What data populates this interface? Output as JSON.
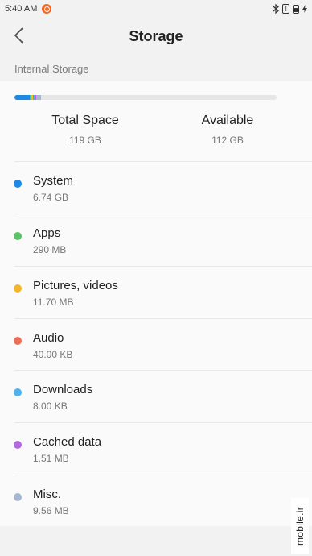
{
  "status_bar": {
    "time": "5:40 AM",
    "battery_mark": "!"
  },
  "header": {
    "title": "Storage"
  },
  "section": {
    "label": "Internal Storage"
  },
  "usage_bar": {
    "segments": [
      {
        "name": "system",
        "fraction": 0.059,
        "color": "#1e88e5"
      },
      {
        "name": "apps",
        "fraction": 0.005,
        "color": "#5cc26a"
      },
      {
        "name": "pictures",
        "fraction": 0.006,
        "color": "#f6b52e"
      },
      {
        "name": "audio",
        "fraction": 0.004,
        "color": "#ec6f55"
      },
      {
        "name": "downloads",
        "fraction": 0.004,
        "color": "#4fb3ec"
      },
      {
        "name": "cached",
        "fraction": 0.006,
        "color": "#b46bde"
      },
      {
        "name": "misc",
        "fraction": 0.018,
        "color": "#a5b8d0"
      }
    ]
  },
  "totals": {
    "total_label": "Total Space",
    "total_value": "119 GB",
    "available_label": "Available",
    "available_value": "112 GB"
  },
  "categories": [
    {
      "label": "System",
      "size": "6.74 GB",
      "color": "#1e88e5"
    },
    {
      "label": "Apps",
      "size": "290 MB",
      "color": "#5cc26a"
    },
    {
      "label": "Pictures, videos",
      "size": "11.70 MB",
      "color": "#f6b52e"
    },
    {
      "label": "Audio",
      "size": "40.00 KB",
      "color": "#ec6f55"
    },
    {
      "label": "Downloads",
      "size": "8.00 KB",
      "color": "#4fb3ec"
    },
    {
      "label": "Cached data",
      "size": "1.51 MB",
      "color": "#b46bde"
    },
    {
      "label": "Misc.",
      "size": "9.56 MB",
      "color": "#a5b8d0"
    }
  ],
  "watermark": {
    "text": "mobile.ir"
  }
}
